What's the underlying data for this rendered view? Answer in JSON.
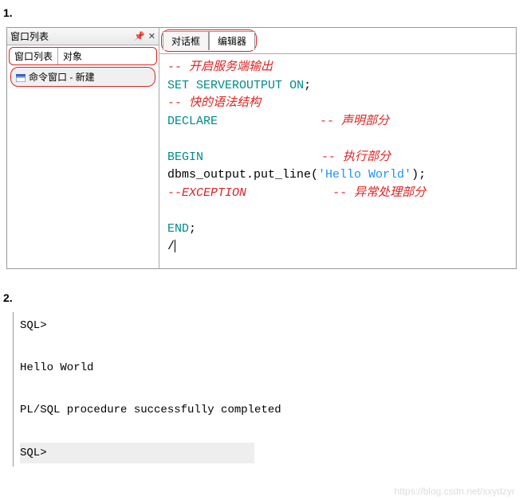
{
  "labels": {
    "section1": "1.",
    "section2": "2."
  },
  "leftPanel": {
    "title": "窗口列表",
    "subTabs": [
      "窗口列表",
      "对象"
    ],
    "treeItem": "命令窗口 - 新建"
  },
  "rightPanel": {
    "tabs": [
      "对话框",
      "编辑器"
    ]
  },
  "code": {
    "l1": "-- 开启服务端输出",
    "l2a": "SET",
    "l2b": "SERVEROUTPUT",
    "l2c": "ON",
    "l2d": ";",
    "l3": "-- 快的语法结构",
    "l4a": "DECLARE",
    "l4b": "-- 声明部分",
    "l5a": "BEGIN",
    "l5b": "-- 执行部分",
    "l6a": "    dbms_output.put_line(",
    "l6b": "'Hello World'",
    "l6c": ");",
    "l7a": "--EXCEPTION",
    "l7b": "-- 异常处理部分",
    "l8a": "END",
    "l8b": ";",
    "l9": "/"
  },
  "console": {
    "prompt1": "SQL>",
    "output1": "Hello World",
    "output2": "PL/SQL procedure successfully completed",
    "prompt2": "SQL>"
  },
  "watermark": "https://blog.csdn.net/xxydzyr"
}
